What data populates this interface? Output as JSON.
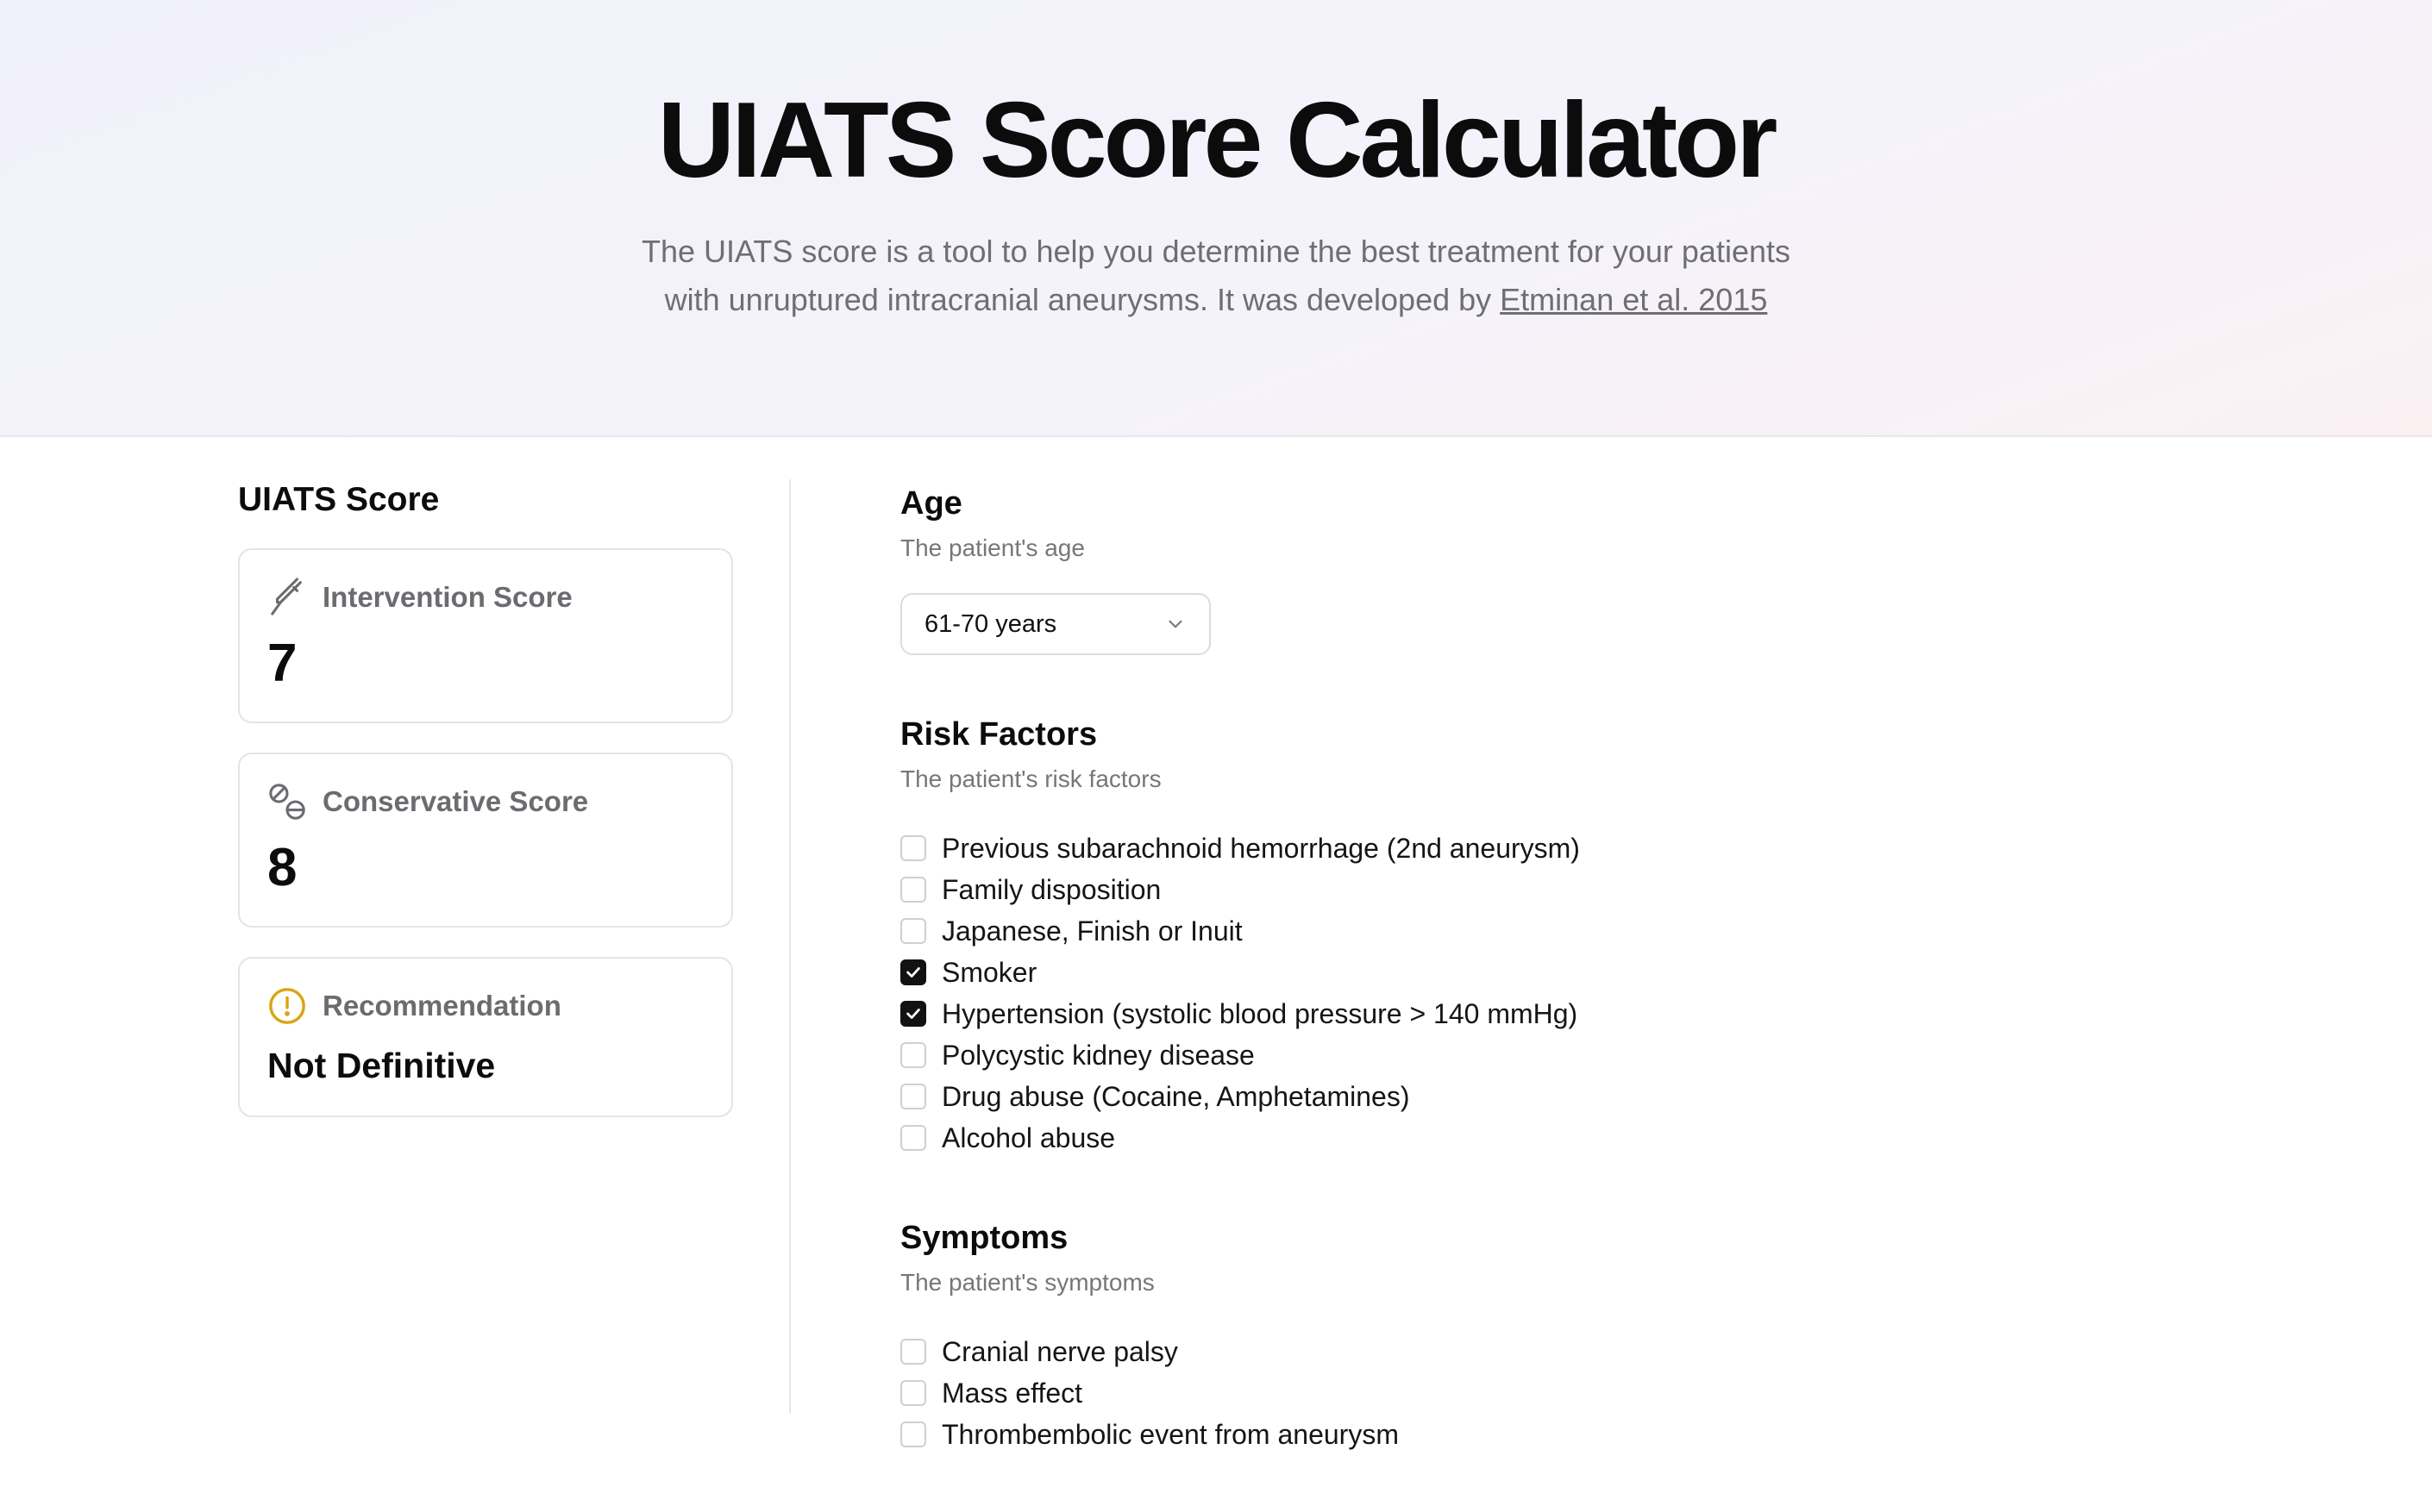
{
  "hero": {
    "title": "UIATS Score Calculator",
    "subtitle_line1": "The UIATS score is a tool to help you determine the best treatment for your patients",
    "subtitle_line2_prefix": "with unruptured intracranial aneurysms. It was developed by ",
    "subtitle_link": "Etminan et al. 2015"
  },
  "score_panel": {
    "title": "UIATS Score",
    "cards": [
      {
        "label": "Intervention Score",
        "value": "7",
        "icon": "scalpel-icon"
      },
      {
        "label": "Conservative Score",
        "value": "8",
        "icon": "pills-icon"
      },
      {
        "label": "Recommendation",
        "value": "Not Definitive",
        "icon": "alert-circle-icon",
        "icon_color": "#d9a514"
      }
    ]
  },
  "age": {
    "title": "Age",
    "description": "The patient's age",
    "selected": "61-70 years"
  },
  "risk_factors": {
    "title": "Risk Factors",
    "description": "The patient's risk factors",
    "options": [
      {
        "label": "Previous subarachnoid hemorrhage (2nd aneurysm)",
        "checked": false
      },
      {
        "label": "Family disposition",
        "checked": false
      },
      {
        "label": "Japanese, Finish or Inuit",
        "checked": false
      },
      {
        "label": "Smoker",
        "checked": true
      },
      {
        "label": "Hypertension (systolic blood pressure > 140 mmHg)",
        "checked": true
      },
      {
        "label": "Polycystic kidney disease",
        "checked": false
      },
      {
        "label": "Drug abuse (Cocaine, Amphetamines)",
        "checked": false
      },
      {
        "label": "Alcohol abuse",
        "checked": false
      }
    ]
  },
  "symptoms": {
    "title": "Symptoms",
    "description": "The patient's symptoms",
    "options": [
      {
        "label": "Cranial nerve palsy",
        "checked": false
      },
      {
        "label": "Mass effect",
        "checked": false
      },
      {
        "label": "Thrombembolic event from aneurysm",
        "checked": false
      }
    ]
  },
  "colors": {
    "accent": "#121212",
    "warning": "#d9a514",
    "muted_text": "#6e6e73"
  }
}
